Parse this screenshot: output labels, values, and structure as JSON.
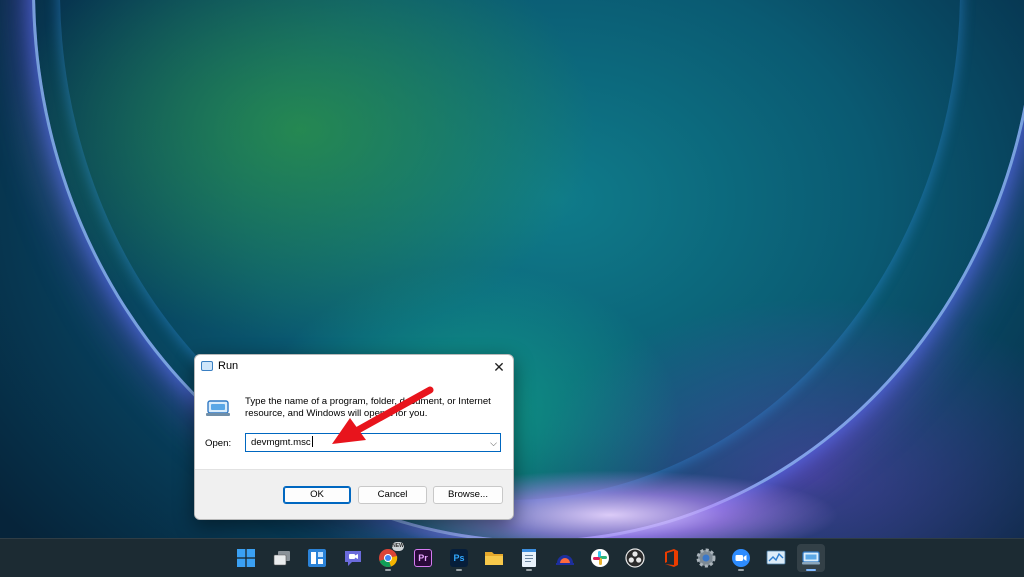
{
  "dialog": {
    "title": "Run",
    "close_glyph": "✕",
    "description": "Type the name of a program, folder, document, or Internet resource, and Windows will open it for you.",
    "open_label": "Open:",
    "open_value": "devmgmt.msc",
    "dropdown_glyph": "⌵",
    "buttons": {
      "ok": "OK",
      "cancel": "Cancel",
      "browse": "Browse..."
    }
  },
  "taskbar": {
    "icons": [
      {
        "name": "start-icon"
      },
      {
        "name": "task-view-icon"
      },
      {
        "name": "widgets-icon"
      },
      {
        "name": "chat-icon"
      },
      {
        "name": "chrome-icon",
        "badge": "NEW"
      },
      {
        "name": "premiere-pro-icon",
        "text": "Pr"
      },
      {
        "name": "photoshop-icon",
        "text": "Ps"
      },
      {
        "name": "file-explorer-icon"
      },
      {
        "name": "notepad-icon"
      },
      {
        "name": "app-icon"
      },
      {
        "name": "slack-icon"
      },
      {
        "name": "obs-icon"
      },
      {
        "name": "office-icon"
      },
      {
        "name": "settings-icon"
      },
      {
        "name": "zoom-icon"
      },
      {
        "name": "task-manager-icon"
      },
      {
        "name": "run-app-icon"
      }
    ]
  },
  "colors": {
    "accent": "#0067c0",
    "taskbar": "#1c2b33",
    "annotation_arrow": "#e8141c"
  }
}
